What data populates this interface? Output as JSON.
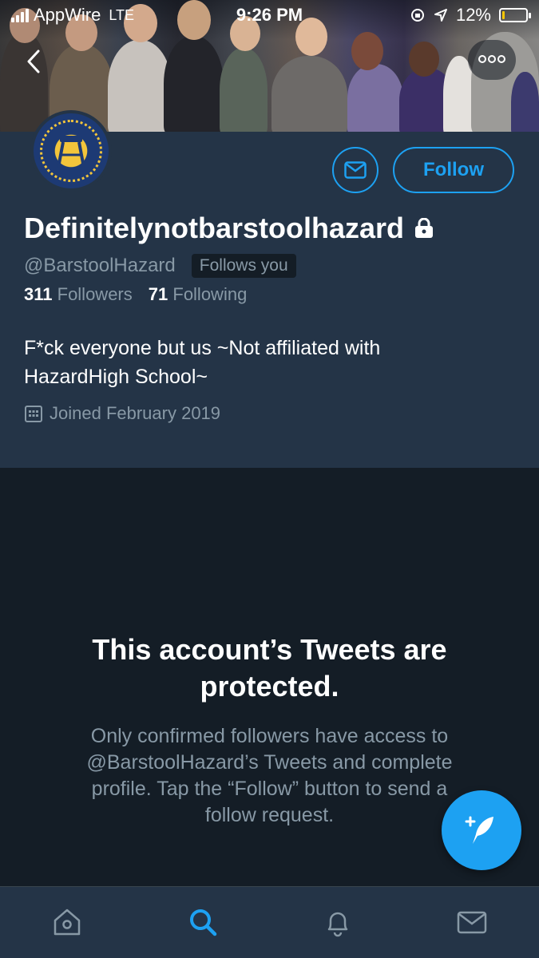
{
  "status_bar": {
    "carrier": "AppWire",
    "network": "LTE",
    "time": "9:26 PM",
    "battery": "12%",
    "battery_level": 0.12
  },
  "profile": {
    "display_name": "Definitelynotbarstoolhazard",
    "handle": "@BarstoolHazard",
    "follows_you": "Follows you",
    "followers_count": "311",
    "followers_label": "Followers",
    "following_count": "71",
    "following_label": "Following",
    "bio_line1": "F*ck everyone but us ~Not affiliated with",
    "bio_line2": "HazardHigh School~",
    "joined": "Joined February 2019",
    "follow_label": "Follow"
  },
  "protected": {
    "title_line1": "This account’s Tweets are",
    "title_line2": "protected.",
    "desc_line1": "Only confirmed followers have access to",
    "desc_line2": "@BarstoolHazard’s Tweets and complete",
    "desc_line3": "profile. Tap the “Follow” button to send a",
    "desc_line4": "follow request."
  },
  "tabs": [
    {
      "name": "home-icon",
      "active": false
    },
    {
      "name": "search-icon",
      "active": true
    },
    {
      "name": "bell-icon",
      "active": false
    },
    {
      "name": "mail-icon",
      "active": false
    }
  ],
  "colors": {
    "accent": "#1da1f2",
    "background": "#141d26",
    "panel": "#243447",
    "muted_text": "#8899a6"
  }
}
